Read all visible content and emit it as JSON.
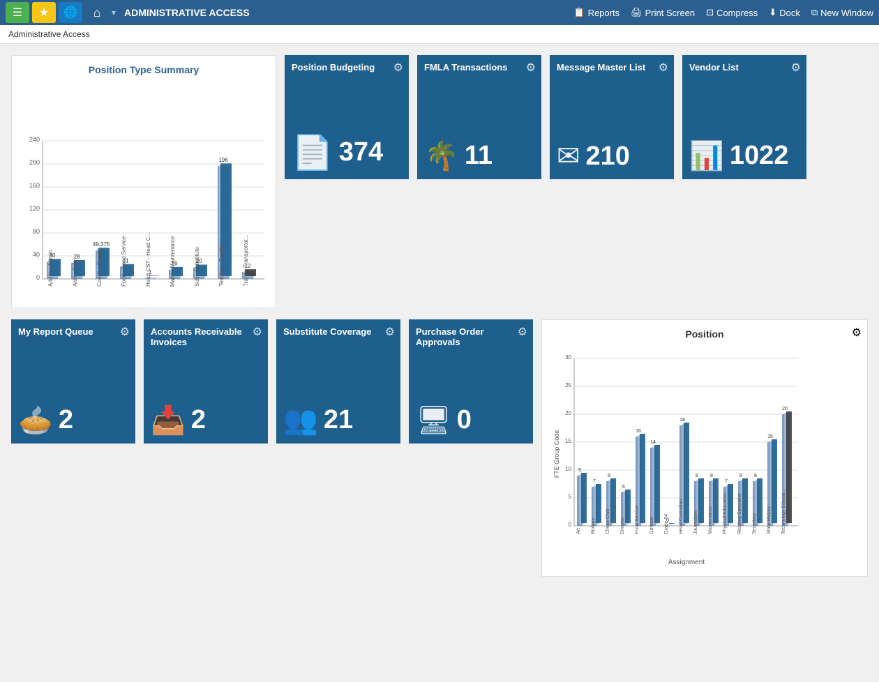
{
  "topbar": {
    "title": "ADMINISTRATIVE ACCESS",
    "menu_icon": "☰",
    "star_icon": "★",
    "globe_icon": "🌐",
    "home_icon": "⌂",
    "arrow_icon": "▾",
    "actions": [
      {
        "label": "Reports",
        "icon": "📋"
      },
      {
        "label": "Print Screen",
        "icon": "🖨"
      },
      {
        "label": "Compress",
        "icon": "⊡"
      },
      {
        "label": "Dock",
        "icon": "⬇"
      },
      {
        "label": "New Window",
        "icon": "⧉"
      }
    ]
  },
  "breadcrumb": "Administrative Access",
  "position_type_chart": {
    "title": "Position Type Summary",
    "bars": [
      {
        "label": "Admin - Admin",
        "value": 30
      },
      {
        "label": "Aide - Aide",
        "value": 28
      },
      {
        "label": "Coach - Coach",
        "value": 49.375
      },
      {
        "label": "Food - Food Service",
        "value": 21
      },
      {
        "label": "Head CST - Head C...",
        "value": 1
      },
      {
        "label": "Maint - Maintenance",
        "value": 16
      },
      {
        "label": "Sub - Substitute",
        "value": 20
      },
      {
        "label": "Teacher - Teacher",
        "value": 196
      },
      {
        "label": "Trans - Transportat...",
        "value": 12
      }
    ],
    "y_labels": [
      0,
      40,
      80,
      120,
      160,
      200,
      240
    ]
  },
  "tiles_top": [
    {
      "id": "position-budgeting",
      "title": "Position Budgeting",
      "count": "374",
      "icon": "📄"
    },
    {
      "id": "fmla-transactions",
      "title": "FMLA Transactions",
      "count": "11",
      "icon": "🌴"
    },
    {
      "id": "message-master-list",
      "title": "Message Master List",
      "count": "210",
      "icon": "✉"
    },
    {
      "id": "vendor-list",
      "title": "Vendor List",
      "count": "1022",
      "icon": "📊"
    }
  ],
  "tiles_bottom": [
    {
      "id": "my-report-queue",
      "title": "My Report Queue",
      "count": "2",
      "icon": "🥧"
    },
    {
      "id": "accounts-receivable",
      "title": "Accounts Receivable Invoices",
      "count": "2",
      "icon": "📥"
    },
    {
      "id": "substitute-coverage",
      "title": "Substitute Coverage",
      "count": "21",
      "icon": "👥"
    },
    {
      "id": "purchase-order-approvals",
      "title": "Purchase Order Approvals",
      "count": "0",
      "icon": "🖥"
    }
  ],
  "position_chart": {
    "title": "Position",
    "x_label": "Assignment",
    "y_label": "FTE Group Code",
    "bars": [
      {
        "label": "Art",
        "value": 9
      },
      {
        "label": "Biology",
        "value": 7
      },
      {
        "label": "Chess Club",
        "value": 8
      },
      {
        "label": "Director",
        "value": 6
      },
      {
        "label": "Food Service",
        "value": 16
      },
      {
        "label": "German",
        "value": 14
      },
      {
        "label": "Grade 04",
        "value": 0
      },
      {
        "label": "Head Custodian",
        "value": 18
      },
      {
        "label": "Journalism",
        "value": 8
      },
      {
        "label": "Maintenance",
        "value": 8
      },
      {
        "label": "Physical Education",
        "value": 7
      },
      {
        "label": "Reading Specialist",
        "value": 8
      },
      {
        "label": "Secretary",
        "value": 8
      },
      {
        "label": "State History",
        "value": 15
      },
      {
        "label": "Technology Educat...",
        "value": 20
      }
    ],
    "y_labels": [
      0,
      5,
      10,
      15,
      20,
      25,
      30
    ]
  }
}
